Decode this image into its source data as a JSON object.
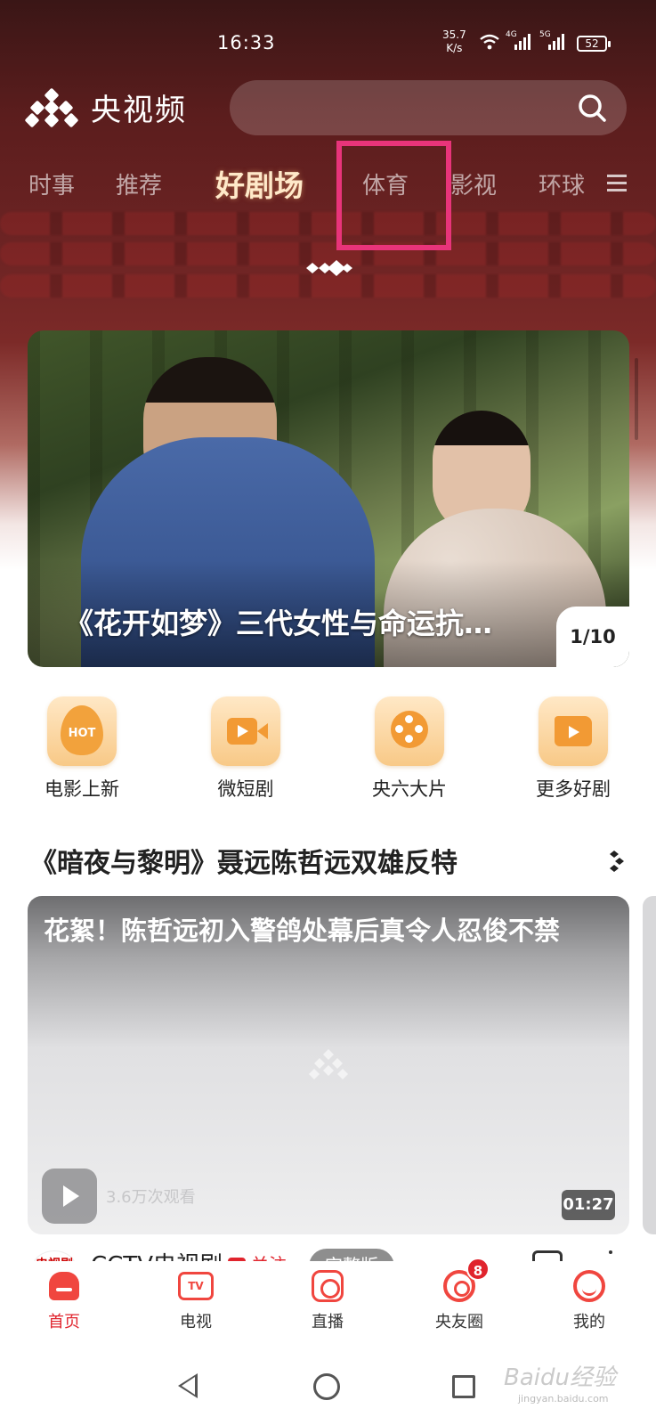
{
  "status_bar": {
    "time": "16:33",
    "speed_value": "35.7",
    "speed_unit": "K/s",
    "net_tag_1": "4G",
    "net_tag_2": "5G",
    "battery": "52"
  },
  "header": {
    "app_name": "央视频",
    "search_placeholder": ""
  },
  "tabs": [
    {
      "label": "时事"
    },
    {
      "label": "推荐"
    },
    {
      "label": "好剧场",
      "active": true
    },
    {
      "label": "体育",
      "highlighted": true
    },
    {
      "label": "影视"
    },
    {
      "label": "环球"
    }
  ],
  "banner": {
    "title": "《花开如梦》三代女性与命运抗…",
    "page_indicator": "1/10"
  },
  "quick_links": [
    {
      "label": "电影上新",
      "icon": "hot-icon",
      "icon_text": "HOT"
    },
    {
      "label": "微短剧",
      "icon": "video-camera-icon"
    },
    {
      "label": "央六大片",
      "icon": "film-reel-icon"
    },
    {
      "label": "更多好剧",
      "icon": "video-folder-icon"
    }
  ],
  "section": {
    "title": "《暗夜与黎明》聂远陈哲远双雄反特"
  },
  "video_card": {
    "title": "花絮！陈哲远初入警鸽处幕后真令人忍俊不禁",
    "views": "3.6万次观看",
    "duration": "01:27"
  },
  "channel": {
    "logo_text": "电视剧",
    "name": "CCTV电视剧",
    "follow_label": "关注",
    "tag": "完整版"
  },
  "bottom_nav": [
    {
      "label": "首页",
      "active": true
    },
    {
      "label": "电视",
      "icon_text": "TV"
    },
    {
      "label": "直播"
    },
    {
      "label": "央友圈",
      "badge": "8"
    },
    {
      "label": "我的"
    }
  ],
  "watermark": {
    "brand": "Baidu经验",
    "url": "jingyan.baidu.com"
  },
  "colors": {
    "accent_red": "#e0242d",
    "highlight_pink": "#e8347a",
    "icon_gold": "#f29a34"
  }
}
